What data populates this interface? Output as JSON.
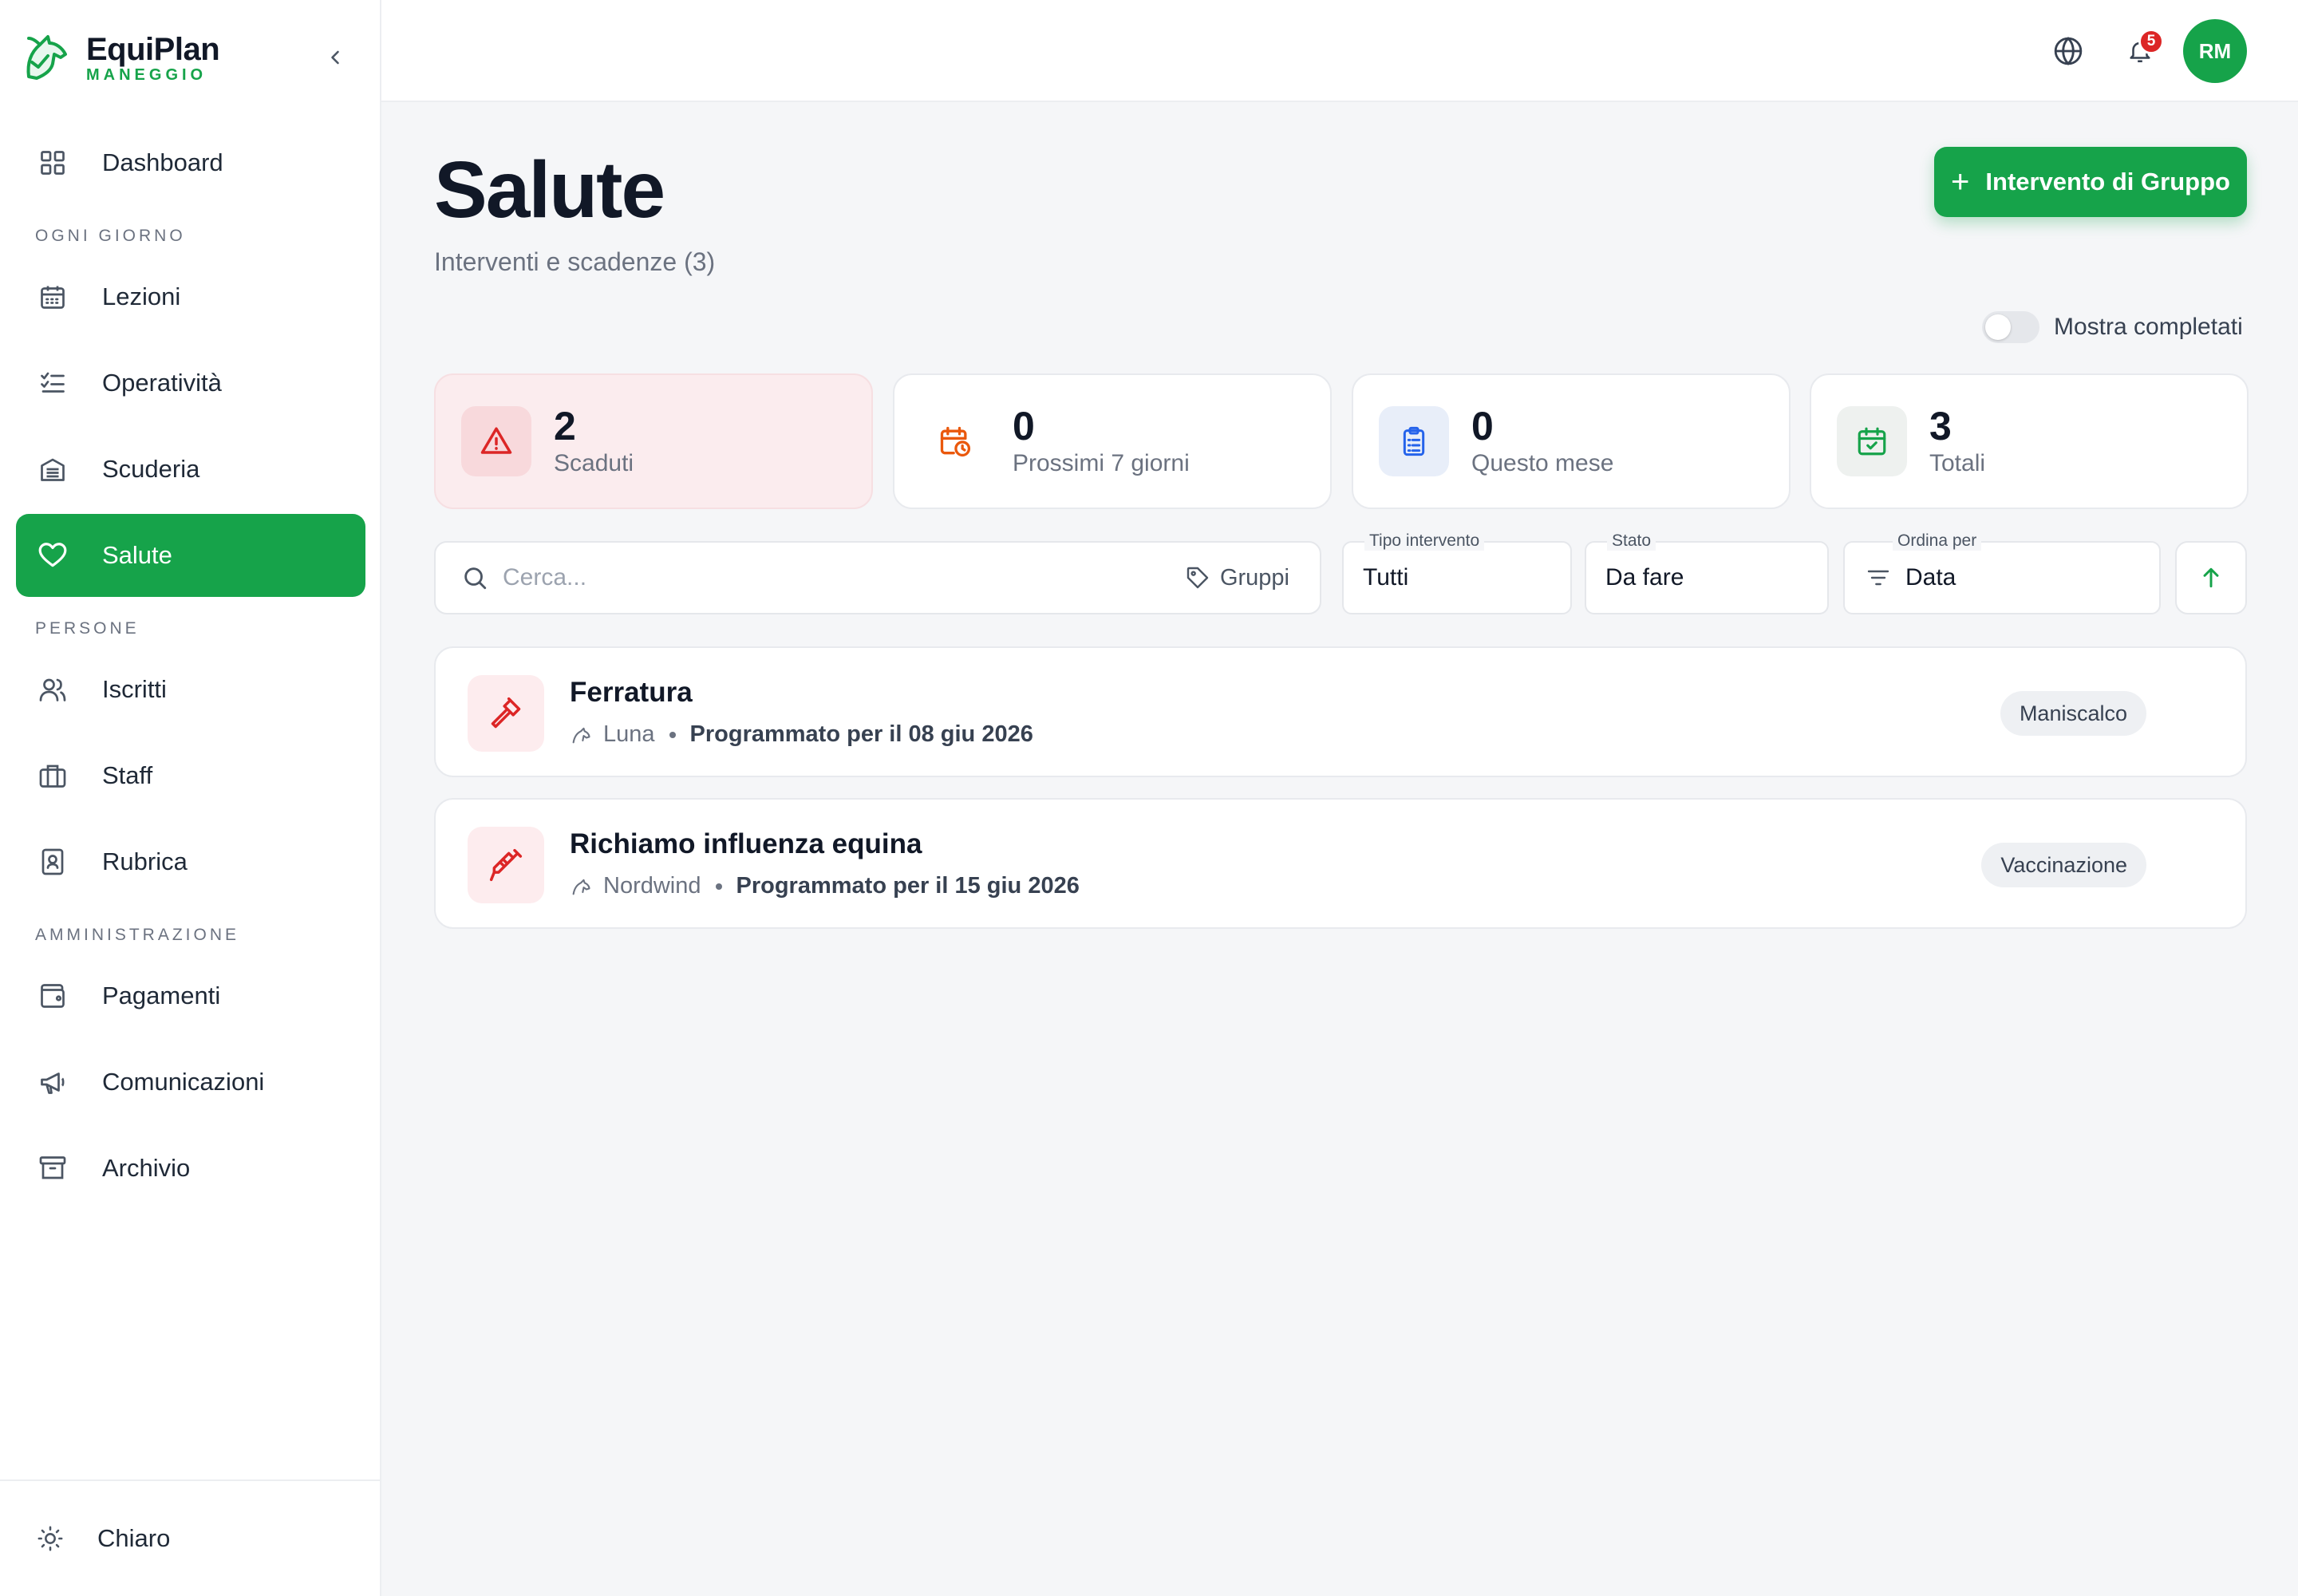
{
  "app": {
    "name": "EquiPlan",
    "subtitle": "MANEGGIO"
  },
  "sidebar": {
    "items": [
      {
        "label": "Dashboard",
        "icon": "grid-icon"
      },
      {
        "label": "Lezioni",
        "icon": "calendar-icon"
      },
      {
        "label": "Operatività",
        "icon": "checklist-icon"
      },
      {
        "label": "Scuderia",
        "icon": "stable-icon"
      },
      {
        "label": "Salute",
        "icon": "heart-icon",
        "active": true
      },
      {
        "label": "Iscritti",
        "icon": "users-icon"
      },
      {
        "label": "Staff",
        "icon": "briefcase-icon"
      },
      {
        "label": "Rubrica",
        "icon": "contact-book-icon"
      },
      {
        "label": "Pagamenti",
        "icon": "wallet-icon"
      },
      {
        "label": "Comunicazioni",
        "icon": "megaphone-icon"
      },
      {
        "label": "Archivio",
        "icon": "archive-icon"
      }
    ],
    "sections": {
      "daily": "OGNI GIORNO",
      "people": "PERSONE",
      "admin": "AMMINISTRAZIONE"
    },
    "theme_label": "Chiaro"
  },
  "topbar": {
    "notifications_count": "5",
    "avatar_initials": "RM"
  },
  "page": {
    "title": "Salute",
    "subtitle": "Interventi e scadenze (3)",
    "group_button": "Intervento di Gruppo",
    "show_completed": "Mostra completati",
    "show_completed_on": false
  },
  "stats": [
    {
      "value": "2",
      "label": "Scaduti",
      "color": "#dc2626"
    },
    {
      "value": "0",
      "label": "Prossimi 7 giorni",
      "color": "#ea580c"
    },
    {
      "value": "0",
      "label": "Questo mese",
      "color": "#2563eb"
    },
    {
      "value": "3",
      "label": "Totali",
      "color": "#16a34a"
    }
  ],
  "filters": {
    "search_placeholder": "Cerca...",
    "groups_label": "Gruppi",
    "type": {
      "label": "Tipo intervento",
      "value": "Tutti"
    },
    "status": {
      "label": "Stato",
      "value": "Da fare"
    },
    "sort": {
      "label": "Ordina per",
      "value": "Data"
    }
  },
  "items": [
    {
      "title": "Ferratura",
      "horse": "Luna",
      "date": "Programmato per il 08 giu 2026",
      "badge": "Maniscalco",
      "icon": "hammer-icon"
    },
    {
      "title": "Richiamo influenza equina",
      "horse": "Nordwind",
      "date": "Programmato per il 15 giu 2026",
      "badge": "Vaccinazione",
      "icon": "syringe-icon"
    }
  ],
  "colors": {
    "brand": "#16a34a",
    "danger": "#dc2626",
    "background": "#f5f6f8"
  }
}
